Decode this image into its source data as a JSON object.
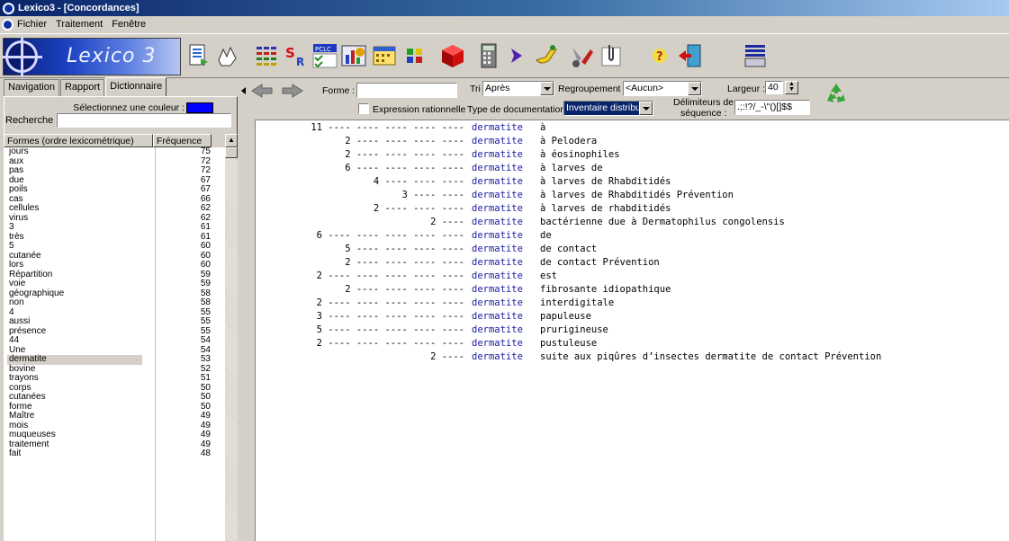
{
  "window": {
    "title": "Lexico3 - [Concordances]"
  },
  "menu": [
    "Fichier",
    "Traitement",
    "Fenêtre"
  ],
  "logo": {
    "text": "Lexico 3"
  },
  "toolbar_icons": [
    "export-icon",
    "hand-icon",
    "grid-icon",
    "sr-icon",
    "pclc-icon",
    "chart-icon",
    "calendar-icon",
    "dots-icon",
    "cube-icon",
    "calculator-icon",
    "arrow-right-icon",
    "pen-icon",
    "tools-icon",
    "paperclip-icon",
    "help-icon",
    "exit-icon",
    "list-icon"
  ],
  "nav": {
    "tabs": [
      "Navigation",
      "Rapport",
      "Dictionnaire"
    ],
    "active_tab": "Dictionnaire",
    "color_label": "Sélectionnez une couleur :",
    "color_value": "#0000ff",
    "search_label": "Recherche :",
    "search_value": "",
    "columns": [
      "Formes (ordre lexicométrique)",
      "Fréquence"
    ],
    "selected": "dermatite",
    "rows": [
      {
        "w": "jours",
        "f": "75"
      },
      {
        "w": "aux",
        "f": "72"
      },
      {
        "w": "pas",
        "f": "72"
      },
      {
        "w": "due",
        "f": "67"
      },
      {
        "w": "poils",
        "f": "67"
      },
      {
        "w": "cas",
        "f": "66"
      },
      {
        "w": "cellules",
        "f": "62"
      },
      {
        "w": "virus",
        "f": "62"
      },
      {
        "w": "3",
        "f": "61"
      },
      {
        "w": "très",
        "f": "61"
      },
      {
        "w": "5",
        "f": "60"
      },
      {
        "w": "cutanée",
        "f": "60"
      },
      {
        "w": "lors",
        "f": "60"
      },
      {
        "w": "Répartition",
        "f": "59"
      },
      {
        "w": "voie",
        "f": "59"
      },
      {
        "w": "géographique",
        "f": "58"
      },
      {
        "w": "non",
        "f": "58"
      },
      {
        "w": "4",
        "f": "55"
      },
      {
        "w": "aussi",
        "f": "55"
      },
      {
        "w": "présence",
        "f": "55"
      },
      {
        "w": "44",
        "f": "54"
      },
      {
        "w": "Une",
        "f": "54"
      },
      {
        "w": "dermatite",
        "f": "53"
      },
      {
        "w": "bovine",
        "f": "52"
      },
      {
        "w": "trayons",
        "f": "51"
      },
      {
        "w": "corps",
        "f": "50"
      },
      {
        "w": "cutanées",
        "f": "50"
      },
      {
        "w": "forme",
        "f": "50"
      },
      {
        "w": "Maître",
        "f": "49"
      },
      {
        "w": "mois",
        "f": "49"
      },
      {
        "w": "muqueuses",
        "f": "49"
      },
      {
        "w": "traitement",
        "f": "49"
      },
      {
        "w": "fait",
        "f": "48"
      }
    ]
  },
  "controls": {
    "forme_label": "Forme :",
    "forme_value": "",
    "tri_label": "Tri :",
    "tri_value": "Après",
    "regroupement_label": "Regroupement :",
    "regroupement_value": "<Aucun>",
    "largeur_label": "Largeur :",
    "largeur_value": "40",
    "regex_label": "Expression rationnelle",
    "regex_checked": false,
    "typedoc_label": "Type de documentation :",
    "typedoc_value": "Inventaire distributio",
    "delim_label_1": "Délimiteurs de",
    "delim_label_2": "séquence :",
    "delim_value": ".;:!?/_-\\\"()[]$$"
  },
  "concordance": {
    "keyword": "dermatite",
    "lines": [
      {
        "ctx": "11 ---- ---- ---- ---- ----",
        "right": "à"
      },
      {
        "ctx": "2 ---- ---- ---- ----",
        "right": "à Pelodera"
      },
      {
        "ctx": "2 ---- ---- ---- ----",
        "right": "à éosinophiles"
      },
      {
        "ctx": "6 ---- ---- ---- ----",
        "right": "à larves de"
      },
      {
        "ctx": "4 ---- ---- ----",
        "right": "à larves de Rhabditidés"
      },
      {
        "ctx": "3 ---- ----",
        "right": "à larves de Rhabditidés Prévention"
      },
      {
        "ctx": "2 ---- ---- ----",
        "right": "à larves de rhabditidés"
      },
      {
        "ctx": "2 ----",
        "right": "bactérienne due à Dermatophilus congolensis"
      },
      {
        "ctx": "6 ---- ---- ---- ---- ----",
        "right": "de"
      },
      {
        "ctx": "5 ---- ---- ---- ----",
        "right": "de contact"
      },
      {
        "ctx": "2 ---- ---- ---- ----",
        "right": "de contact Prévention"
      },
      {
        "ctx": "2 ---- ---- ---- ---- ----",
        "right": "est"
      },
      {
        "ctx": "2 ---- ---- ---- ----",
        "right": "fibrosante idiopathique"
      },
      {
        "ctx": "2 ---- ---- ---- ---- ----",
        "right": "interdigitale"
      },
      {
        "ctx": "3 ---- ---- ---- ---- ----",
        "right": "papuleuse"
      },
      {
        "ctx": "5 ---- ---- ---- ---- ----",
        "right": "prurigineuse"
      },
      {
        "ctx": "2 ---- ---- ---- ---- ----",
        "right": "pustuleuse"
      },
      {
        "ctx": "2 ----",
        "right": "suite aux piqûres d’insectes dermatite de contact Prévention"
      }
    ]
  }
}
